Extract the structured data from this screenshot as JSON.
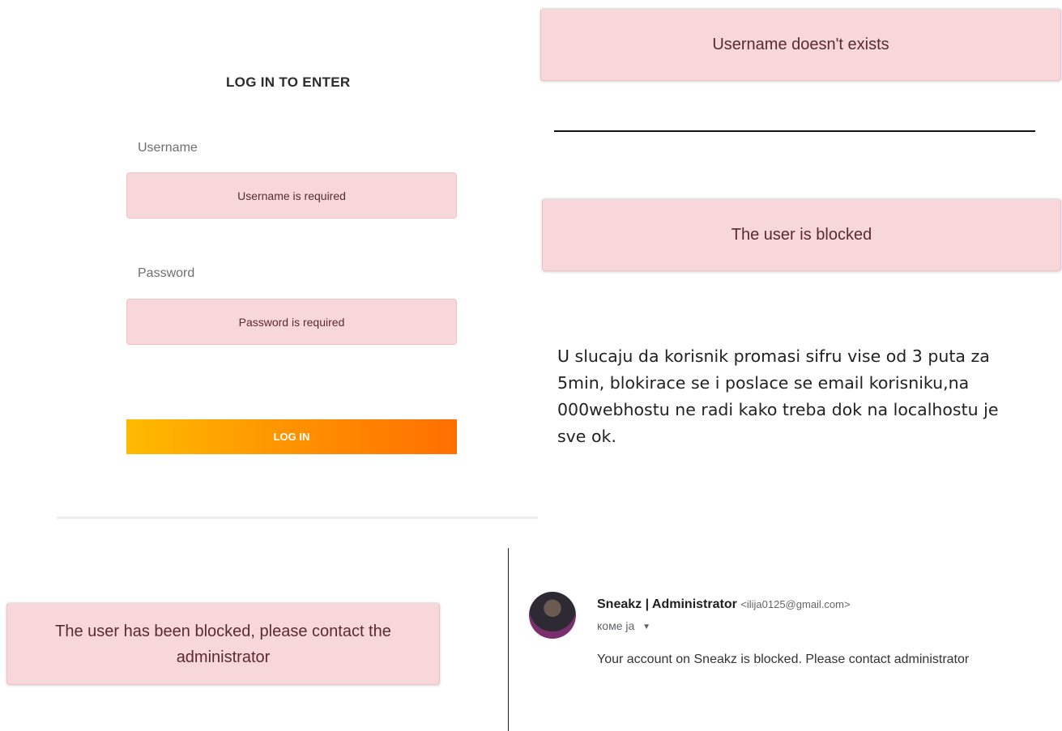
{
  "login_form": {
    "title": "LOG IN TO ENTER",
    "username_label": "Username",
    "username_error": "Username is required",
    "password_label": "Password",
    "password_error": "Password is required",
    "login_button": "LOG IN"
  },
  "alerts": {
    "username_not_exists": "Username doesn't exists",
    "user_blocked": "The user is blocked",
    "user_has_been_blocked_line1": "The user has been blocked, please contact the",
    "user_has_been_blocked_line2": "administrator"
  },
  "note": {
    "text": "U slucaju da korisnik promasi sifru vise od 3 puta za 5min, blokirace se i poslace se email korisniku,na 000webhostu ne radi kako treba dok na localhostu je sve ok."
  },
  "email": {
    "sender_name": "Sneakz | Administrator",
    "sender_email": "<ilija0125@gmail.com>",
    "recipient": "коме ја",
    "body": "Your account on Sneakz is blocked. Please contact administrator"
  },
  "colors": {
    "alert_bg": "#f8d7da",
    "button_gradient_start": "#ffbb00",
    "button_gradient_end": "#ff6f00"
  },
  "icons": [
    "caret-down-icon",
    "avatar"
  ]
}
